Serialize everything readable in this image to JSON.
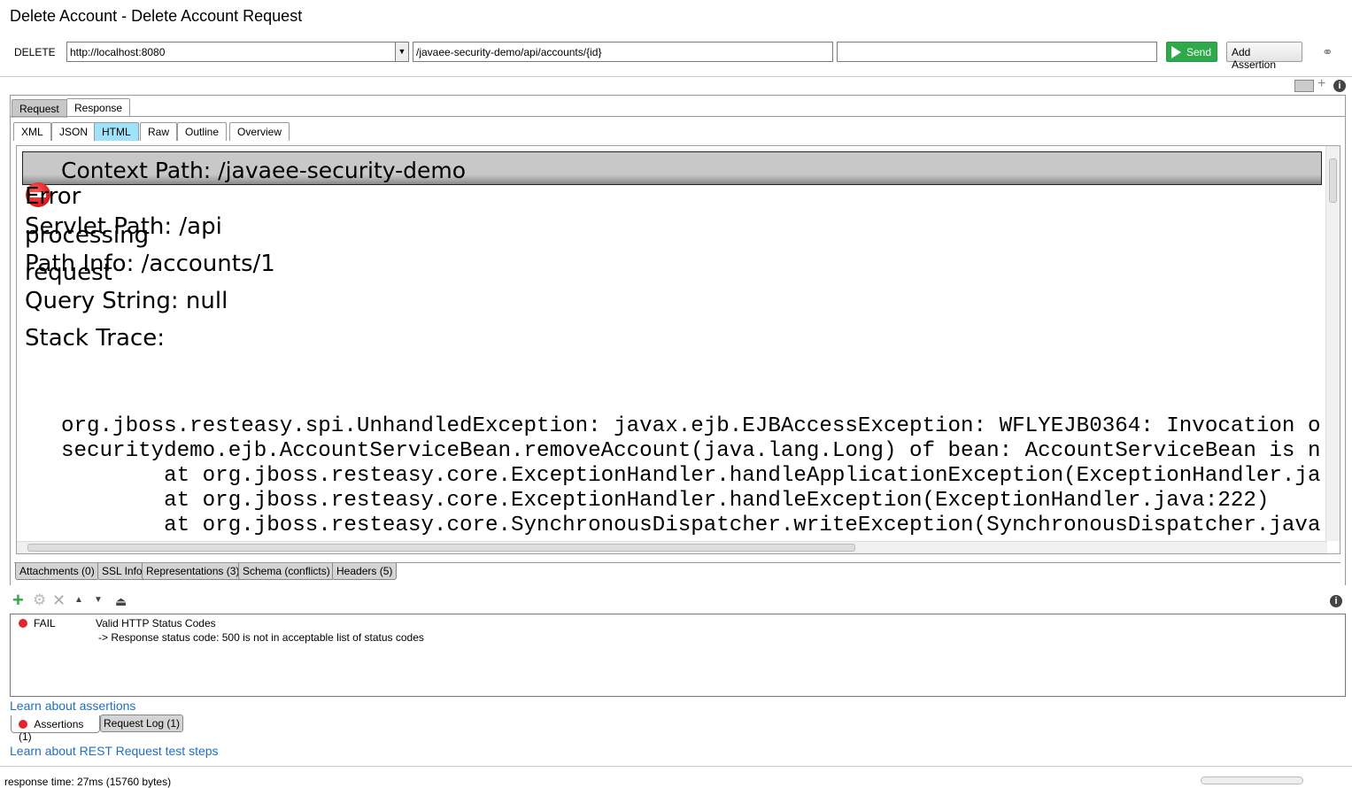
{
  "window": {
    "title": "Delete Account - Delete Account Request"
  },
  "toolbar": {
    "method": "DELETE",
    "endpoint": "http://localhost:8080",
    "resource": "/javaee-security-demo/api/accounts/{id}",
    "params": "",
    "send_label": "Send",
    "add_assertion_label": "Add Assertion"
  },
  "main_tabs": [
    {
      "label": "Request"
    },
    {
      "label": "Response"
    }
  ],
  "view_tabs": [
    {
      "label": "XML"
    },
    {
      "label": "JSON"
    },
    {
      "label": "HTML"
    },
    {
      "label": "Raw"
    },
    {
      "label": "Outline"
    },
    {
      "label": "Overview"
    }
  ],
  "response": {
    "context_path": "Context Path:  /javaee-security-demo",
    "error_words": [
      "Error",
      "processing",
      "request"
    ],
    "servlet_path": "Servlet Path:  /api",
    "path_info": "Path Info:  /accounts/1",
    "query_string": "Query String:  null",
    "stack_trace_label": "Stack Trace:",
    "stack_lines": [
      "org.jboss.resteasy.spi.UnhandledException: javax.ejb.EJBAccessException: WFLYEJB0364: Invocation o",
      "securitydemo.ejb.AccountServiceBean.removeAccount(java.lang.Long) of bean: AccountServiceBean is n",
      "        at org.jboss.resteasy.core.ExceptionHandler.handleApplicationException(ExceptionHandler.ja",
      "        at org.jboss.resteasy.core.ExceptionHandler.handleException(ExceptionHandler.java:222)",
      "        at org.jboss.resteasy.core.SynchronousDispatcher.writeException(SynchronousDispatcher.java"
    ]
  },
  "bottom_tabs": [
    {
      "label": "Attachments (0)"
    },
    {
      "label": "SSL Info"
    },
    {
      "label": "Representations (3)"
    },
    {
      "label": "Schema (conflicts)"
    },
    {
      "label": "Headers (5)"
    }
  ],
  "assertions": {
    "rows": [
      {
        "status": "FAIL",
        "status_color": "#e3242b",
        "name": "Valid HTTP Status Codes",
        "detail": "-> Response status code: 500 is not in acceptable list of status codes"
      }
    ],
    "learn_link": "Learn about assertions"
  },
  "log_tabs": [
    {
      "label": "Assertions (1)"
    },
    {
      "label": "Request Log (1)"
    }
  ],
  "learn_rest_link": "Learn about REST Request test steps",
  "status_bar": {
    "text": "response time: 27ms (15760 bytes)"
  }
}
